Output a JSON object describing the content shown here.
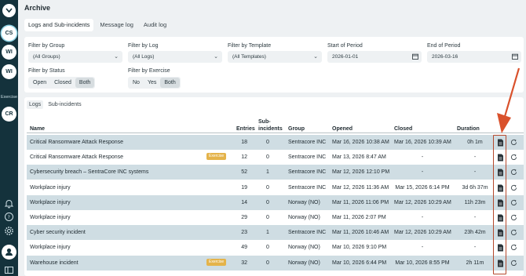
{
  "page": {
    "title": "Archive",
    "tabs": [
      "Logs and Sub-incidents",
      "Message log",
      "Audit log"
    ]
  },
  "rail": {
    "avatars": [
      "CS",
      "WI",
      "WI"
    ],
    "exercise_label": "Exercise",
    "exercise_avatar": "CR"
  },
  "filters": {
    "group_label": "Filter by Group",
    "group_value": "(All Groups)",
    "log_label": "Filter by Log",
    "log_value": "(All Logs)",
    "template_label": "Filter by Template",
    "template_value": "(All Templates)",
    "start_label": "Start of Period",
    "start_value": "2026-01-01",
    "end_label": "End of Period",
    "end_value": "2026-03-16",
    "status_label": "Filter by Status",
    "status_options": [
      "Open",
      "Closed",
      "Both"
    ],
    "exercise_label": "Filter by Exercise",
    "exercise_options": [
      "No",
      "Yes",
      "Both"
    ]
  },
  "subtabs": [
    "Logs",
    "Sub-incidents"
  ],
  "table": {
    "headers": {
      "name": "Name",
      "entries": "Entries",
      "sub_line1": "Sub-",
      "sub_line2": "incidents",
      "group": "Group",
      "opened": "Opened",
      "closed": "Closed",
      "duration": "Duration"
    },
    "rows": [
      {
        "name": "Critical Ransomware Attack Response",
        "badge": "",
        "entries": "18",
        "sub": "0",
        "group": "Sentracore INC",
        "opened": "Mar 16, 2026 10:38 AM",
        "closed": "Mar 16, 2026 10:39 AM",
        "duration": "0h 1m"
      },
      {
        "name": "Critical Ransomware Attack Response",
        "badge": "Exercise",
        "entries": "12",
        "sub": "0",
        "group": "Sentracore INC",
        "opened": "Mar 13, 2026 8:47 AM",
        "closed": "-",
        "duration": "-"
      },
      {
        "name": "Cybersecurity breach – SentraCore INC systems",
        "badge": "",
        "entries": "52",
        "sub": "1",
        "group": "Sentracore INC",
        "opened": "Mar 12, 2026 12:10 PM",
        "closed": "-",
        "duration": "-"
      },
      {
        "name": "Workplace injury",
        "badge": "",
        "entries": "19",
        "sub": "0",
        "group": "Sentracore INC",
        "opened": "Mar 12, 2026 11:36 AM",
        "closed": "Mar 15, 2026 6:14 PM",
        "duration": "3d 6h 37m"
      },
      {
        "name": "Workplace injury",
        "badge": "",
        "entries": "14",
        "sub": "0",
        "group": "Norway (NO)",
        "opened": "Mar 11, 2026 11:06 PM",
        "closed": "Mar 12, 2026 10:29 AM",
        "duration": "11h 23m"
      },
      {
        "name": "Workplace injury",
        "badge": "",
        "entries": "29",
        "sub": "0",
        "group": "Norway (NO)",
        "opened": "Mar 11, 2026 2:07 PM",
        "closed": "-",
        "duration": "-"
      },
      {
        "name": "Cyber security incident",
        "badge": "",
        "entries": "23",
        "sub": "1",
        "group": "Sentracore INC",
        "opened": "Mar 11, 2026 10:46 AM",
        "closed": "Mar 12, 2026 10:29 AM",
        "duration": "23h 42m"
      },
      {
        "name": "Workplace injury",
        "badge": "",
        "entries": "49",
        "sub": "0",
        "group": "Norway (NO)",
        "opened": "Mar 10, 2026 9:10 PM",
        "closed": "-",
        "duration": "-"
      },
      {
        "name": "Warehouse incident",
        "badge": "Exercise",
        "entries": "32",
        "sub": "0",
        "group": "Norway (NO)",
        "opened": "Mar 10, 2026 6:44 PM",
        "closed": "Mar 10, 2026 8:55 PM",
        "duration": "2h 11m"
      }
    ]
  },
  "colors": {
    "rail": "#14323c",
    "row_shade": "#cfdde3",
    "badge": "#e4b34a",
    "annotation": "#b4492d"
  }
}
